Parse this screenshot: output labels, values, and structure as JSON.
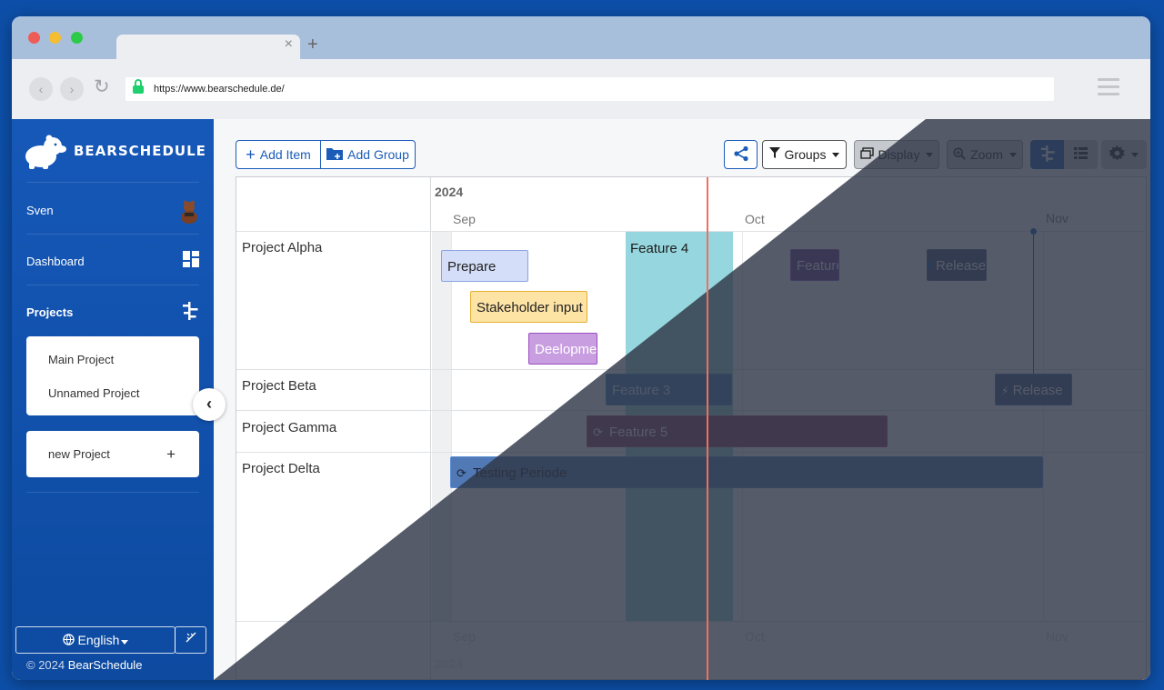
{
  "browser": {
    "url": "https://www.bearschedule.de/"
  },
  "sidebar": {
    "app_name": "BEARSCHEDULE",
    "user_name": "Sven",
    "dashboard_label": "Dashboard",
    "projects_label": "Projects",
    "project_list": [
      "Main Project",
      "Unnamed Project"
    ],
    "new_project_label": "new Project",
    "new_project_plus": "+",
    "language_label": "English",
    "copyright_prefix": "© 2024",
    "copyright_brand": "BearSchedule"
  },
  "toolbar": {
    "add_item_label": "Add Item",
    "add_group_label": "Add Group",
    "groups_label": "Groups",
    "display_label": "Display",
    "zoom_label": "Zoom"
  },
  "timeline": {
    "year": "2024",
    "months": [
      "Sep",
      "Oct",
      "Nov"
    ],
    "groups": [
      "Project Alpha",
      "Project Beta",
      "Project Gamma",
      "Project Delta"
    ],
    "items": {
      "prepare": "Prepare",
      "stakeholder": "Stakeholder input",
      "development": "Deelopment",
      "feature4": "Feature 4",
      "feature_alpha": "Feature",
      "release_alpha": "Release",
      "feature3": "Feature 3",
      "release_beta": "Release",
      "feature5": "Feature 5",
      "testing": "Testing Periode"
    }
  },
  "icons": {
    "share": "share-icon",
    "filter": "filter-icon",
    "zoom": "magnifier-icon",
    "timeline_view": "timeline-icon",
    "list_view": "list-icon",
    "settings": "gear-icon"
  },
  "colors": {
    "brand": "#1658b8",
    "dark_theme": "#2f3747"
  }
}
